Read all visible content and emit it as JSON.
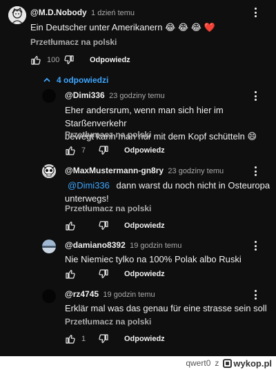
{
  "comments": [
    {
      "author": "@M.D.Nobody",
      "time": "1 dzień temu",
      "text": "Ein Deutscher unter Amerikanern 😂 😂 😂 ❤️",
      "translate": "Przetłumacz na polski",
      "likes": "100",
      "reply": "Odpowiedz"
    },
    {
      "author": "@Dimi336",
      "time": "23 godziny temu",
      "text_line1": "Eher andersrum, wenn man sich hier im Starßenverkehr",
      "text_line2": "bewegt kann man nur mit dem Kopf schütteln 😄",
      "translate": "Przetłumacz na polski",
      "likes": "7",
      "reply": "Odpowiedz"
    },
    {
      "author": "@MaxMustermann-gn8ry",
      "time": "23 godziny temu",
      "mention": "@Dimi336",
      "text_line1": "dann warst du noch nicht in Osteuropa",
      "text_line2": "unterwegs!",
      "translate": "Przetłumacz na polski",
      "likes": "",
      "reply": "Odpowiedz"
    },
    {
      "author": "@damiano8392",
      "time": "19 godzin temu",
      "text": "Nie Niemiec tylko na 100% Polak albo Ruski",
      "likes": "",
      "reply": "Odpowiedz"
    },
    {
      "author": "@rz4745",
      "time": "19 godzin temu",
      "text": "Erklär mal was das genau für eine strasse sein soll",
      "translate": "Przetłumacz na polski",
      "likes": "1",
      "reply": "Odpowiedz"
    }
  ],
  "replies_toggle": "4 odpowiedzi",
  "footer": {
    "user": "qwert0",
    "separator": "z",
    "site": "wykop.pl"
  },
  "colors": {
    "background": "#0f0f0f",
    "link": "#3ea6ff",
    "muted": "#aaaaaa"
  }
}
